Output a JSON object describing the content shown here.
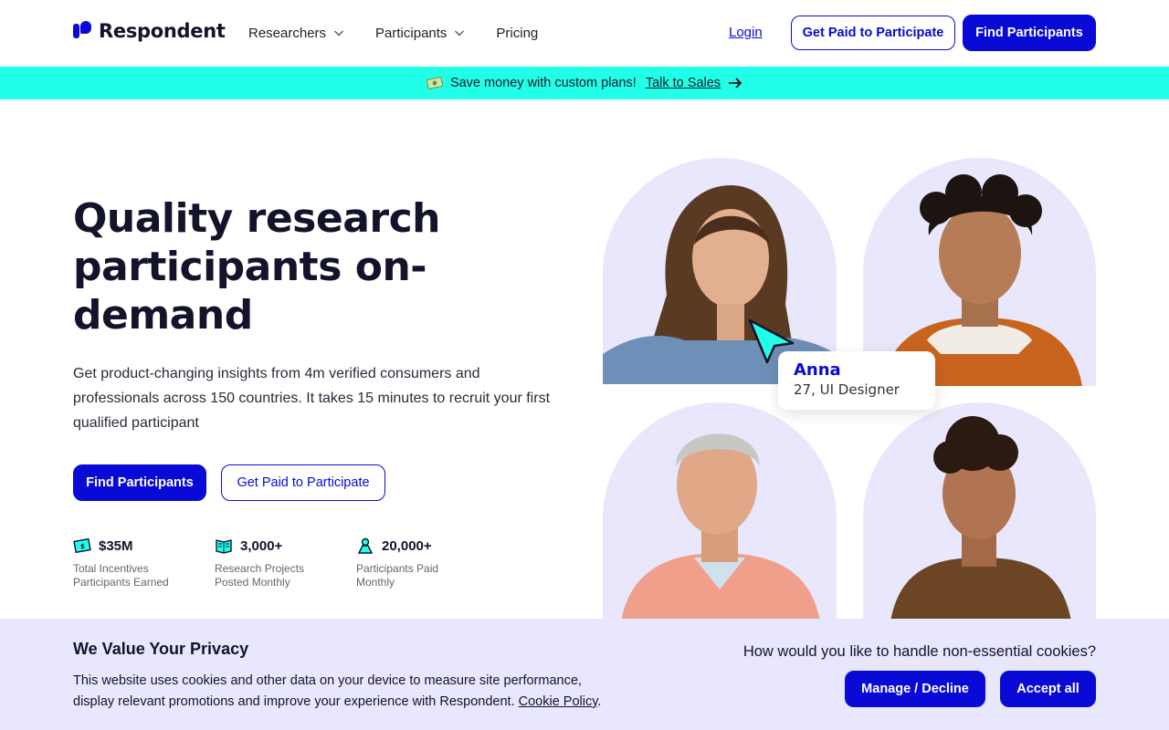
{
  "nav": {
    "logo_text": "Respondent",
    "menu": [
      {
        "label": "Researchers",
        "has_dropdown": true
      },
      {
        "label": "Participants",
        "has_dropdown": true
      },
      {
        "label": "Pricing",
        "has_dropdown": false
      }
    ],
    "login": "Login",
    "get_paid": "Get Paid to Participate",
    "find": "Find Participants"
  },
  "promo": {
    "text": "Save money with custom plans!",
    "link": "Talk to Sales",
    "icon": "money-icon",
    "color": "#22ffe9"
  },
  "hero": {
    "title": "Quality research participants on-demand",
    "subtitle": "Get product-changing insights from 4m verified consumers and professionals across 150 countries. It takes 15 minutes to recruit your first qualified participant",
    "find_button": "Find Participants",
    "paid_button": "Get Paid to Participate"
  },
  "stats": [
    {
      "value": "$35M",
      "label": "Total Incentives Participants Earned",
      "icon": "money-bill-icon"
    },
    {
      "value": "3,000+",
      "label": "Research Projects Posted Monthly",
      "icon": "book-icon"
    },
    {
      "value": "20,000+",
      "label": "Participants Paid Monthly",
      "icon": "person-icon"
    }
  ],
  "profile_card": {
    "name": "Anna",
    "role": "27, UI Designer"
  },
  "cookie": {
    "title": "We Value Your Privacy",
    "text": "This website uses cookies and other data on your device to measure site performance, display relevant promotions and improve your experience with Respondent.",
    "policy_link": "Cookie Policy",
    "question": "How would you like to handle non-essential cookies?",
    "manage": "Manage / Decline",
    "accept": "Accept all"
  },
  "colors": {
    "brand": "#0a0ad6",
    "accent": "#22ffe9",
    "banner_bg": "#e8e7fd",
    "photo_bg": "#e9e7fb"
  }
}
